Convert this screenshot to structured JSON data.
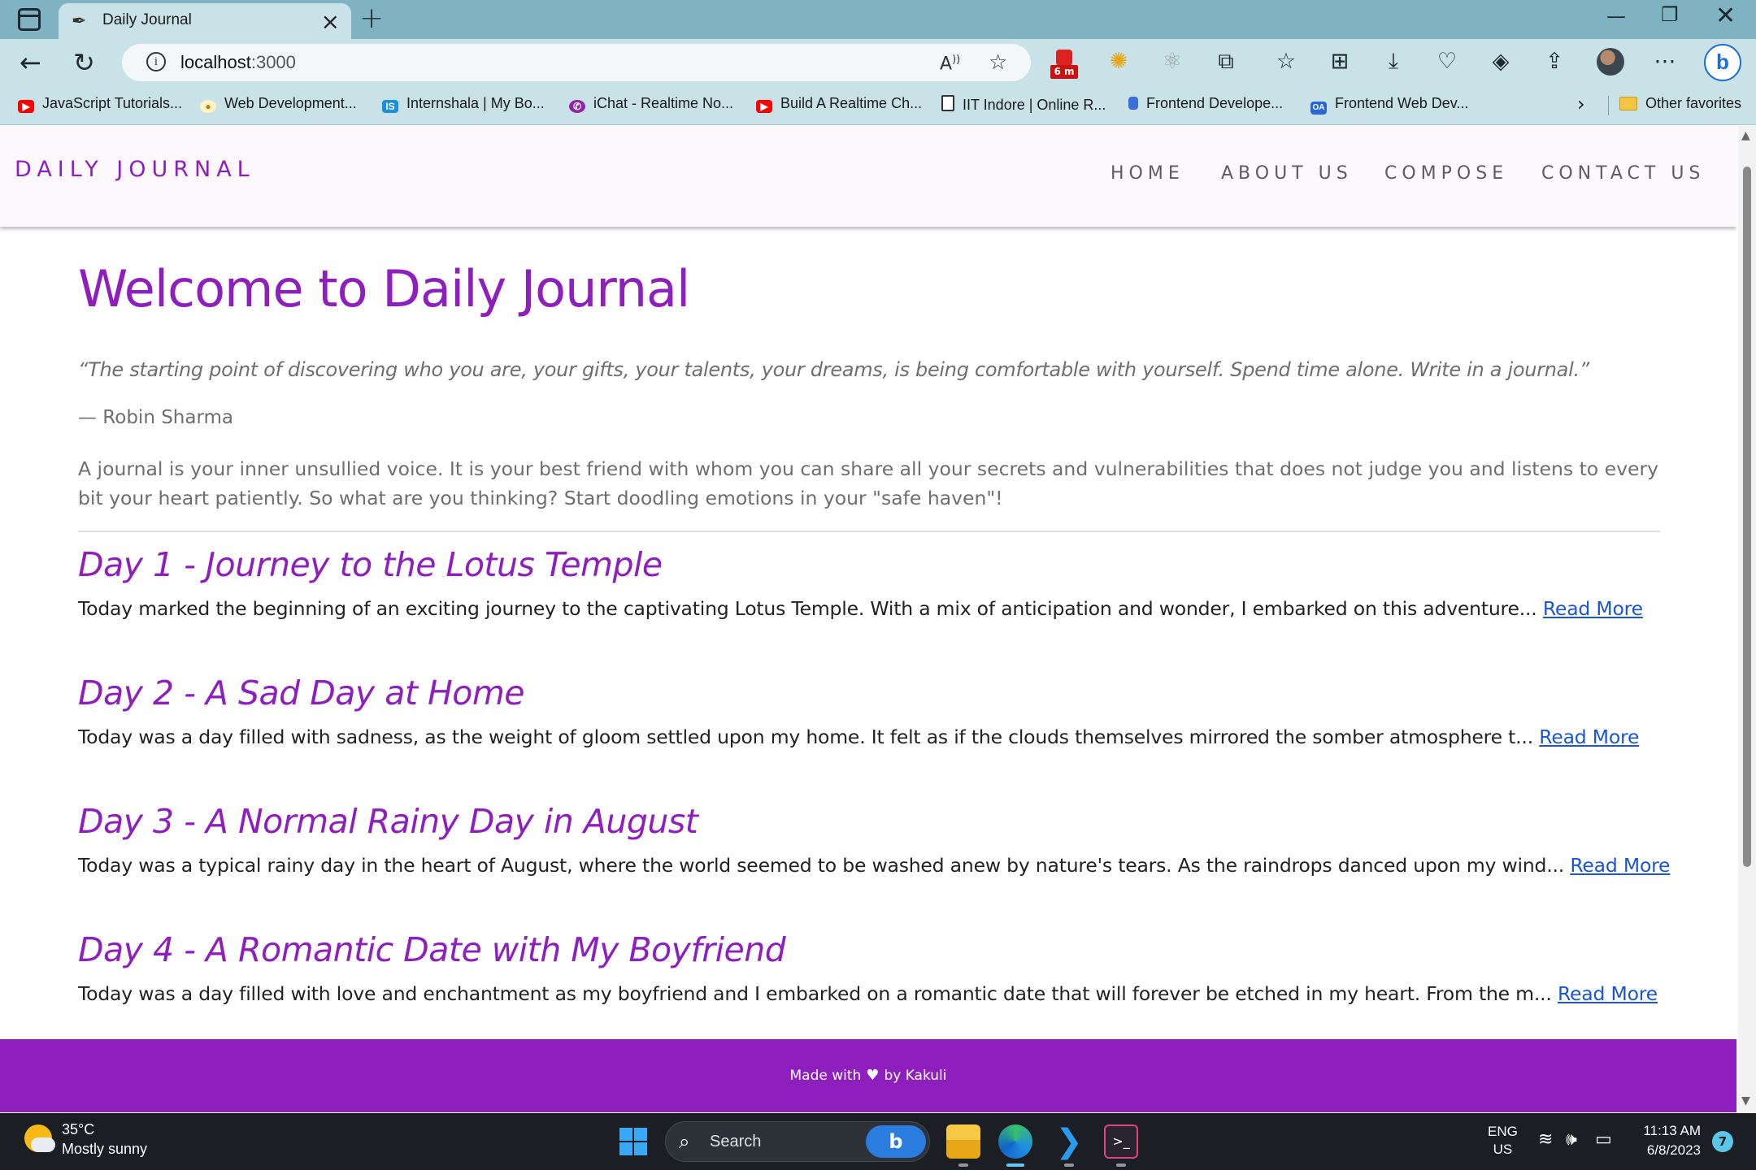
{
  "browser": {
    "tab_title": "Daily Journal",
    "url_host": "localhost",
    "url_port": ":3000",
    "extension_badge": "6 m",
    "bookmarks": [
      {
        "label": "JavaScript Tutorials...",
        "icon": "youtube-icon",
        "color": "#ff0000"
      },
      {
        "label": "Web Development...",
        "icon": "web-dev-icon",
        "color": "#e6b422"
      },
      {
        "label": "Internshala | My Bo...",
        "icon": "internshala-icon",
        "color": "#1a8fdd"
      },
      {
        "label": "iChat - Realtime No...",
        "icon": "ichat-icon",
        "color": "#8e24aa"
      },
      {
        "label": "Build A Realtime Ch...",
        "icon": "youtube-icon",
        "color": "#ff0000"
      },
      {
        "label": "IIT Indore | Online R...",
        "icon": "document-icon",
        "color": "#ffffff"
      },
      {
        "label": "Frontend Develope...",
        "icon": "frontend-icon",
        "color": "#3b6fd8"
      },
      {
        "label": "Frontend Web Dev...",
        "icon": "oa-icon",
        "color": "#2a65d8"
      }
    ],
    "other_favorites": "Other favorites"
  },
  "site": {
    "brand": "DAILY JOURNAL",
    "nav": [
      "HOME",
      "ABOUT US",
      "COMPOSE",
      "CONTACT US"
    ],
    "hero_title": "Welcome to Daily Journal",
    "quote": "“The starting point of discovering who you are, your gifts, your talents, your dreams, is being comfortable with yourself. Spend time alone. Write in a journal.”",
    "author": "— Robin Sharma",
    "intro": "A journal is your inner unsullied voice. It is your best friend with whom you can share all your secrets and vulnerabilities that does not judge you and listens to every bit your heart patiently. So what are you thinking? Start doodling emotions in your \"safe haven\"!",
    "read_more": "Read More",
    "posts": [
      {
        "title": "Day 1 - Journey to the Lotus Temple",
        "excerpt": "Today marked the beginning of an exciting journey to the captivating Lotus Temple. With a mix of anticipation and wonder, I embarked on this adventure..."
      },
      {
        "title": "Day 2 - A Sad Day at Home",
        "excerpt": "Today was a day filled with sadness, as the weight of gloom settled upon my home. It felt as if the clouds themselves mirrored the somber atmosphere t..."
      },
      {
        "title": "Day 3 - A Normal Rainy Day in August",
        "excerpt": "Today was a typical rainy day in the heart of August, where the world seemed to be washed anew by nature's tears. As the raindrops danced upon my wind..."
      },
      {
        "title": "Day 4 - A Romantic Date with My Boyfriend",
        "excerpt": "Today was a day filled with love and enchantment as my boyfriend and I embarked on a romantic date that will forever be etched in my heart. From the m..."
      }
    ],
    "footer_prefix": "Made with",
    "footer_suffix": "by Kakuli",
    "accent_color": "#8e1ebd",
    "link_color": "#1a55d6"
  },
  "taskbar": {
    "temperature": "35°C",
    "condition": "Mostly sunny",
    "search_label": "Search",
    "lang_line1": "ENG",
    "lang_line2": "US",
    "time": "11:13 AM",
    "date": "6/8/2023",
    "notification_count": "7"
  }
}
